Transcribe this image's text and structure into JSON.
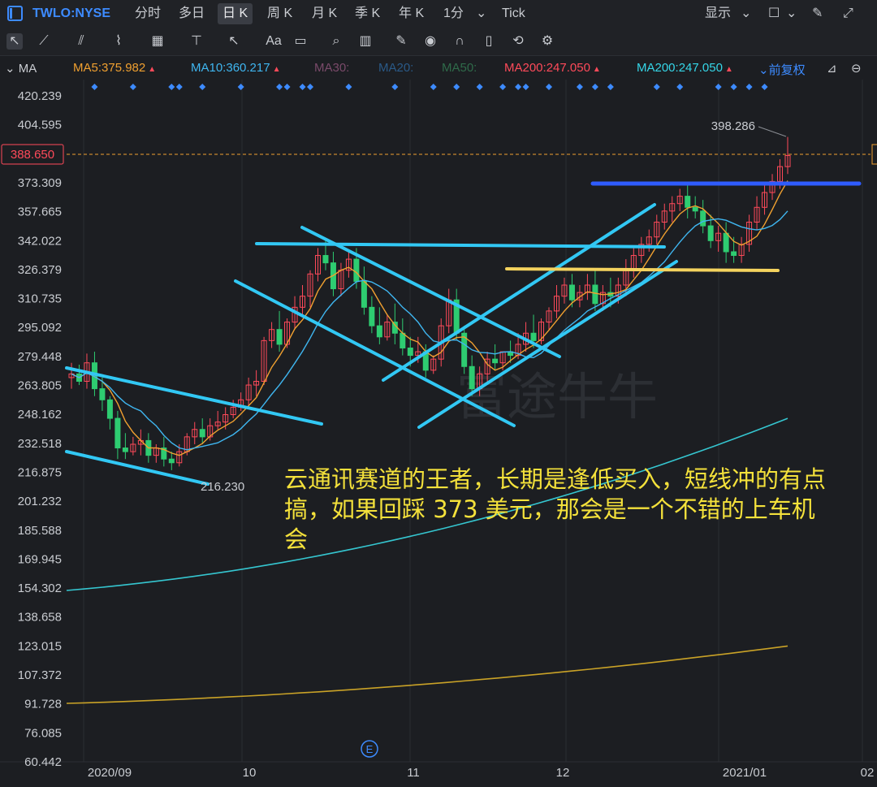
{
  "toolbar": {
    "symbol": "TWLO:NYSE",
    "periods": [
      "分时",
      "多日",
      "日 K",
      "周 K",
      "月 K",
      "季 K",
      "年 K",
      "1分",
      "Tick"
    ],
    "active_period": "日 K",
    "display_label": "显示"
  },
  "ma_bar": {
    "label": "MA",
    "items": [
      {
        "text": "MA5:375.982",
        "color": "#f0a030",
        "arrow": "▲"
      },
      {
        "text": "MA10:360.217",
        "color": "#3fb6f0",
        "arrow": "▲"
      },
      {
        "text": "MA30:",
        "color": "#7a4a6a",
        "arrow": ""
      },
      {
        "text": "MA20:",
        "color": "#2a5a88",
        "arrow": ""
      },
      {
        "text": "MA50:",
        "color": "#2f6b4a",
        "arrow": ""
      },
      {
        "text": "MA200:247.050",
        "color": "#ff4a5a",
        "arrow": "▲"
      },
      {
        "text": "MA200:247.050",
        "color": "#35d6e8",
        "arrow": "▲"
      }
    ],
    "adjust_label": "前复权"
  },
  "chart_data": {
    "type": "candlestick",
    "y_ticks": [
      420.239,
      404.595,
      388.65,
      373.309,
      357.665,
      342.022,
      326.379,
      310.735,
      295.092,
      279.448,
      263.805,
      248.162,
      232.518,
      216.875,
      201.232,
      185.588,
      169.945,
      154.302,
      138.658,
      123.015,
      107.372,
      91.728,
      76.085,
      60.442
    ],
    "ylim": [
      60.442,
      420.239
    ],
    "current_price": "388.650",
    "x_labels": [
      "2020/09",
      "10",
      "11",
      "12",
      "2021/01",
      "02"
    ],
    "high_label": "398.286",
    "low_label": "216.230",
    "event_marker": "E",
    "up_color": "#ff4a5a",
    "down_color": "#2ecc71",
    "candles": [
      [
        268,
        276,
        270,
        262
      ],
      [
        270,
        275,
        266,
        264
      ],
      [
        266,
        281,
        276,
        262
      ],
      [
        276,
        282,
        262,
        258
      ],
      [
        262,
        268,
        256,
        250
      ],
      [
        256,
        258,
        246,
        240
      ],
      [
        246,
        250,
        230,
        224
      ],
      [
        230,
        238,
        228,
        224
      ],
      [
        228,
        236,
        232,
        226
      ],
      [
        232,
        240,
        234,
        226
      ],
      [
        234,
        238,
        226,
        222
      ],
      [
        226,
        232,
        230,
        222
      ],
      [
        230,
        236,
        224,
        220
      ],
      [
        224,
        228,
        222,
        218
      ],
      [
        222,
        232,
        228,
        220
      ],
      [
        228,
        238,
        236,
        226
      ],
      [
        236,
        244,
        240,
        232
      ],
      [
        240,
        246,
        236,
        232
      ],
      [
        236,
        246,
        242,
        234
      ],
      [
        242,
        250,
        244,
        240
      ],
      [
        244,
        252,
        248,
        240
      ],
      [
        248,
        256,
        252,
        246
      ],
      [
        252,
        260,
        256,
        250
      ],
      [
        256,
        268,
        264,
        252
      ],
      [
        264,
        272,
        266,
        258
      ],
      [
        266,
        290,
        288,
        264
      ],
      [
        288,
        298,
        294,
        284
      ],
      [
        294,
        304,
        286,
        282
      ],
      [
        286,
        300,
        298,
        284
      ],
      [
        298,
        312,
        306,
        294
      ],
      [
        306,
        318,
        312,
        302
      ],
      [
        312,
        326,
        324,
        306
      ],
      [
        324,
        338,
        334,
        320
      ],
      [
        334,
        342,
        330,
        326
      ],
      [
        330,
        336,
        316,
        312
      ],
      [
        316,
        330,
        326,
        312
      ],
      [
        326,
        336,
        332,
        322
      ],
      [
        332,
        338,
        320,
        316
      ],
      [
        320,
        328,
        306,
        302
      ],
      [
        306,
        312,
        296,
        292
      ],
      [
        296,
        306,
        290,
        286
      ],
      [
        290,
        302,
        298,
        288
      ],
      [
        298,
        308,
        292,
        286
      ],
      [
        292,
        300,
        284,
        280
      ],
      [
        284,
        290,
        280,
        274
      ],
      [
        280,
        290,
        282,
        276
      ],
      [
        282,
        286,
        272,
        268
      ],
      [
        272,
        280,
        278,
        270
      ],
      [
        278,
        300,
        296,
        274
      ],
      [
        296,
        316,
        310,
        292
      ],
      [
        310,
        316,
        292,
        288
      ],
      [
        292,
        296,
        274,
        270
      ],
      [
        274,
        280,
        262,
        258
      ],
      [
        262,
        274,
        270,
        258
      ],
      [
        270,
        282,
        278,
        266
      ],
      [
        278,
        286,
        276,
        272
      ],
      [
        276,
        282,
        282,
        272
      ],
      [
        282,
        288,
        280,
        276
      ],
      [
        280,
        292,
        286,
        278
      ],
      [
        286,
        298,
        292,
        282
      ],
      [
        292,
        302,
        288,
        284
      ],
      [
        288,
        300,
        298,
        286
      ],
      [
        298,
        306,
        304,
        294
      ],
      [
        304,
        318,
        312,
        300
      ],
      [
        312,
        322,
        318,
        308
      ],
      [
        318,
        324,
        310,
        306
      ],
      [
        310,
        318,
        314,
        306
      ],
      [
        314,
        324,
        318,
        310
      ],
      [
        318,
        326,
        308,
        304
      ],
      [
        308,
        318,
        314,
        304
      ],
      [
        314,
        322,
        312,
        306
      ],
      [
        312,
        322,
        318,
        308
      ],
      [
        318,
        332,
        326,
        312
      ],
      [
        326,
        338,
        334,
        322
      ],
      [
        334,
        344,
        340,
        330
      ],
      [
        340,
        348,
        344,
        336
      ],
      [
        344,
        356,
        352,
        340
      ],
      [
        352,
        362,
        358,
        348
      ],
      [
        358,
        366,
        362,
        352
      ],
      [
        362,
        370,
        366,
        358
      ],
      [
        366,
        372,
        360,
        354
      ],
      [
        360,
        366,
        358,
        354
      ],
      [
        358,
        364,
        350,
        346
      ],
      [
        350,
        356,
        342,
        338
      ],
      [
        342,
        350,
        346,
        336
      ],
      [
        346,
        352,
        336,
        330
      ],
      [
        336,
        344,
        334,
        330
      ],
      [
        334,
        344,
        340,
        330
      ],
      [
        340,
        356,
        352,
        336
      ],
      [
        352,
        366,
        360,
        348
      ],
      [
        360,
        372,
        368,
        356
      ],
      [
        368,
        378,
        374,
        364
      ],
      [
        374,
        386,
        382,
        370
      ],
      [
        382,
        398,
        388,
        378
      ]
    ],
    "ma_long_1": {
      "name": "MA200",
      "color": "#35c6d0",
      "from": 153,
      "to": 246
    },
    "ma_long_2": {
      "name": "",
      "color": "#c9a227",
      "from": 92,
      "to": 123
    }
  },
  "annotation": "云通讯赛道的王者，长期是逢低买入，短线冲的有点搞，如果回踩 373 美元，那会是一个不错的上车机会",
  "watermark": "富途牛牛"
}
